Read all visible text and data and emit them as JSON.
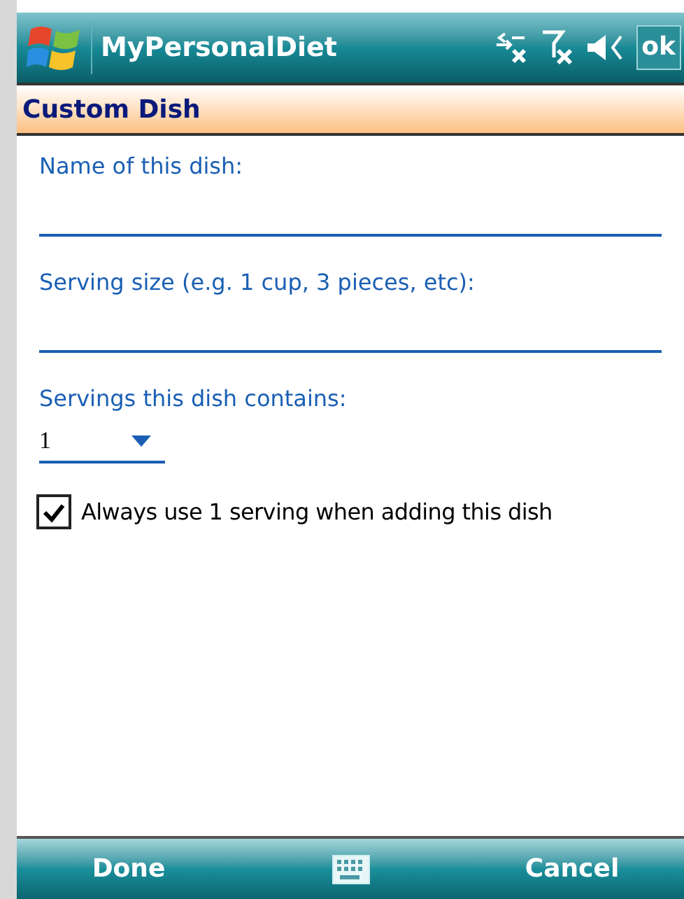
{
  "title_bar": {
    "title": "MyPersonalDiet",
    "ok": "ok"
  },
  "header": {
    "title": "Custom Dish"
  },
  "fields": [
    {
      "kind": "text",
      "label": "Name of this dish:"
    },
    {
      "kind": "text",
      "label": "Serving size (e.g. 1 cup, 3 pieces, etc):"
    },
    {
      "kind": "dropdown",
      "label": "Servings this dish contains:",
      "value": "1"
    }
  ],
  "checkbox": {
    "label": "Always use 1 serving when adding this dish",
    "checked": true
  },
  "softkeys": {
    "left": "Done",
    "right": "Cancel"
  }
}
